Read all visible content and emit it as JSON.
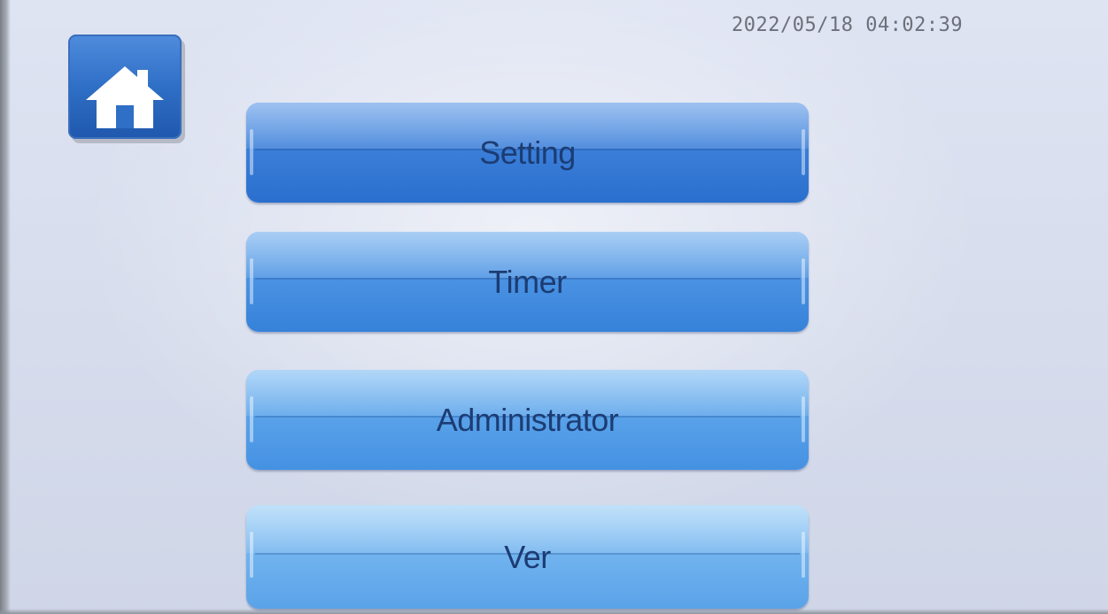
{
  "status": {
    "datetime": "2022/05/18 04:02:39"
  },
  "toolbar": {
    "home_icon": "home-icon"
  },
  "menu": {
    "items": [
      {
        "label": "Setting"
      },
      {
        "label": "Timer"
      },
      {
        "label": "Administrator"
      },
      {
        "label": "Ver"
      }
    ]
  },
  "colors": {
    "background": "#d9dfee",
    "home_button": "#2f6fc6",
    "button_blue": "#3b7fd9",
    "label_text": "#1c3c73",
    "datetime_text": "#6d7079"
  }
}
